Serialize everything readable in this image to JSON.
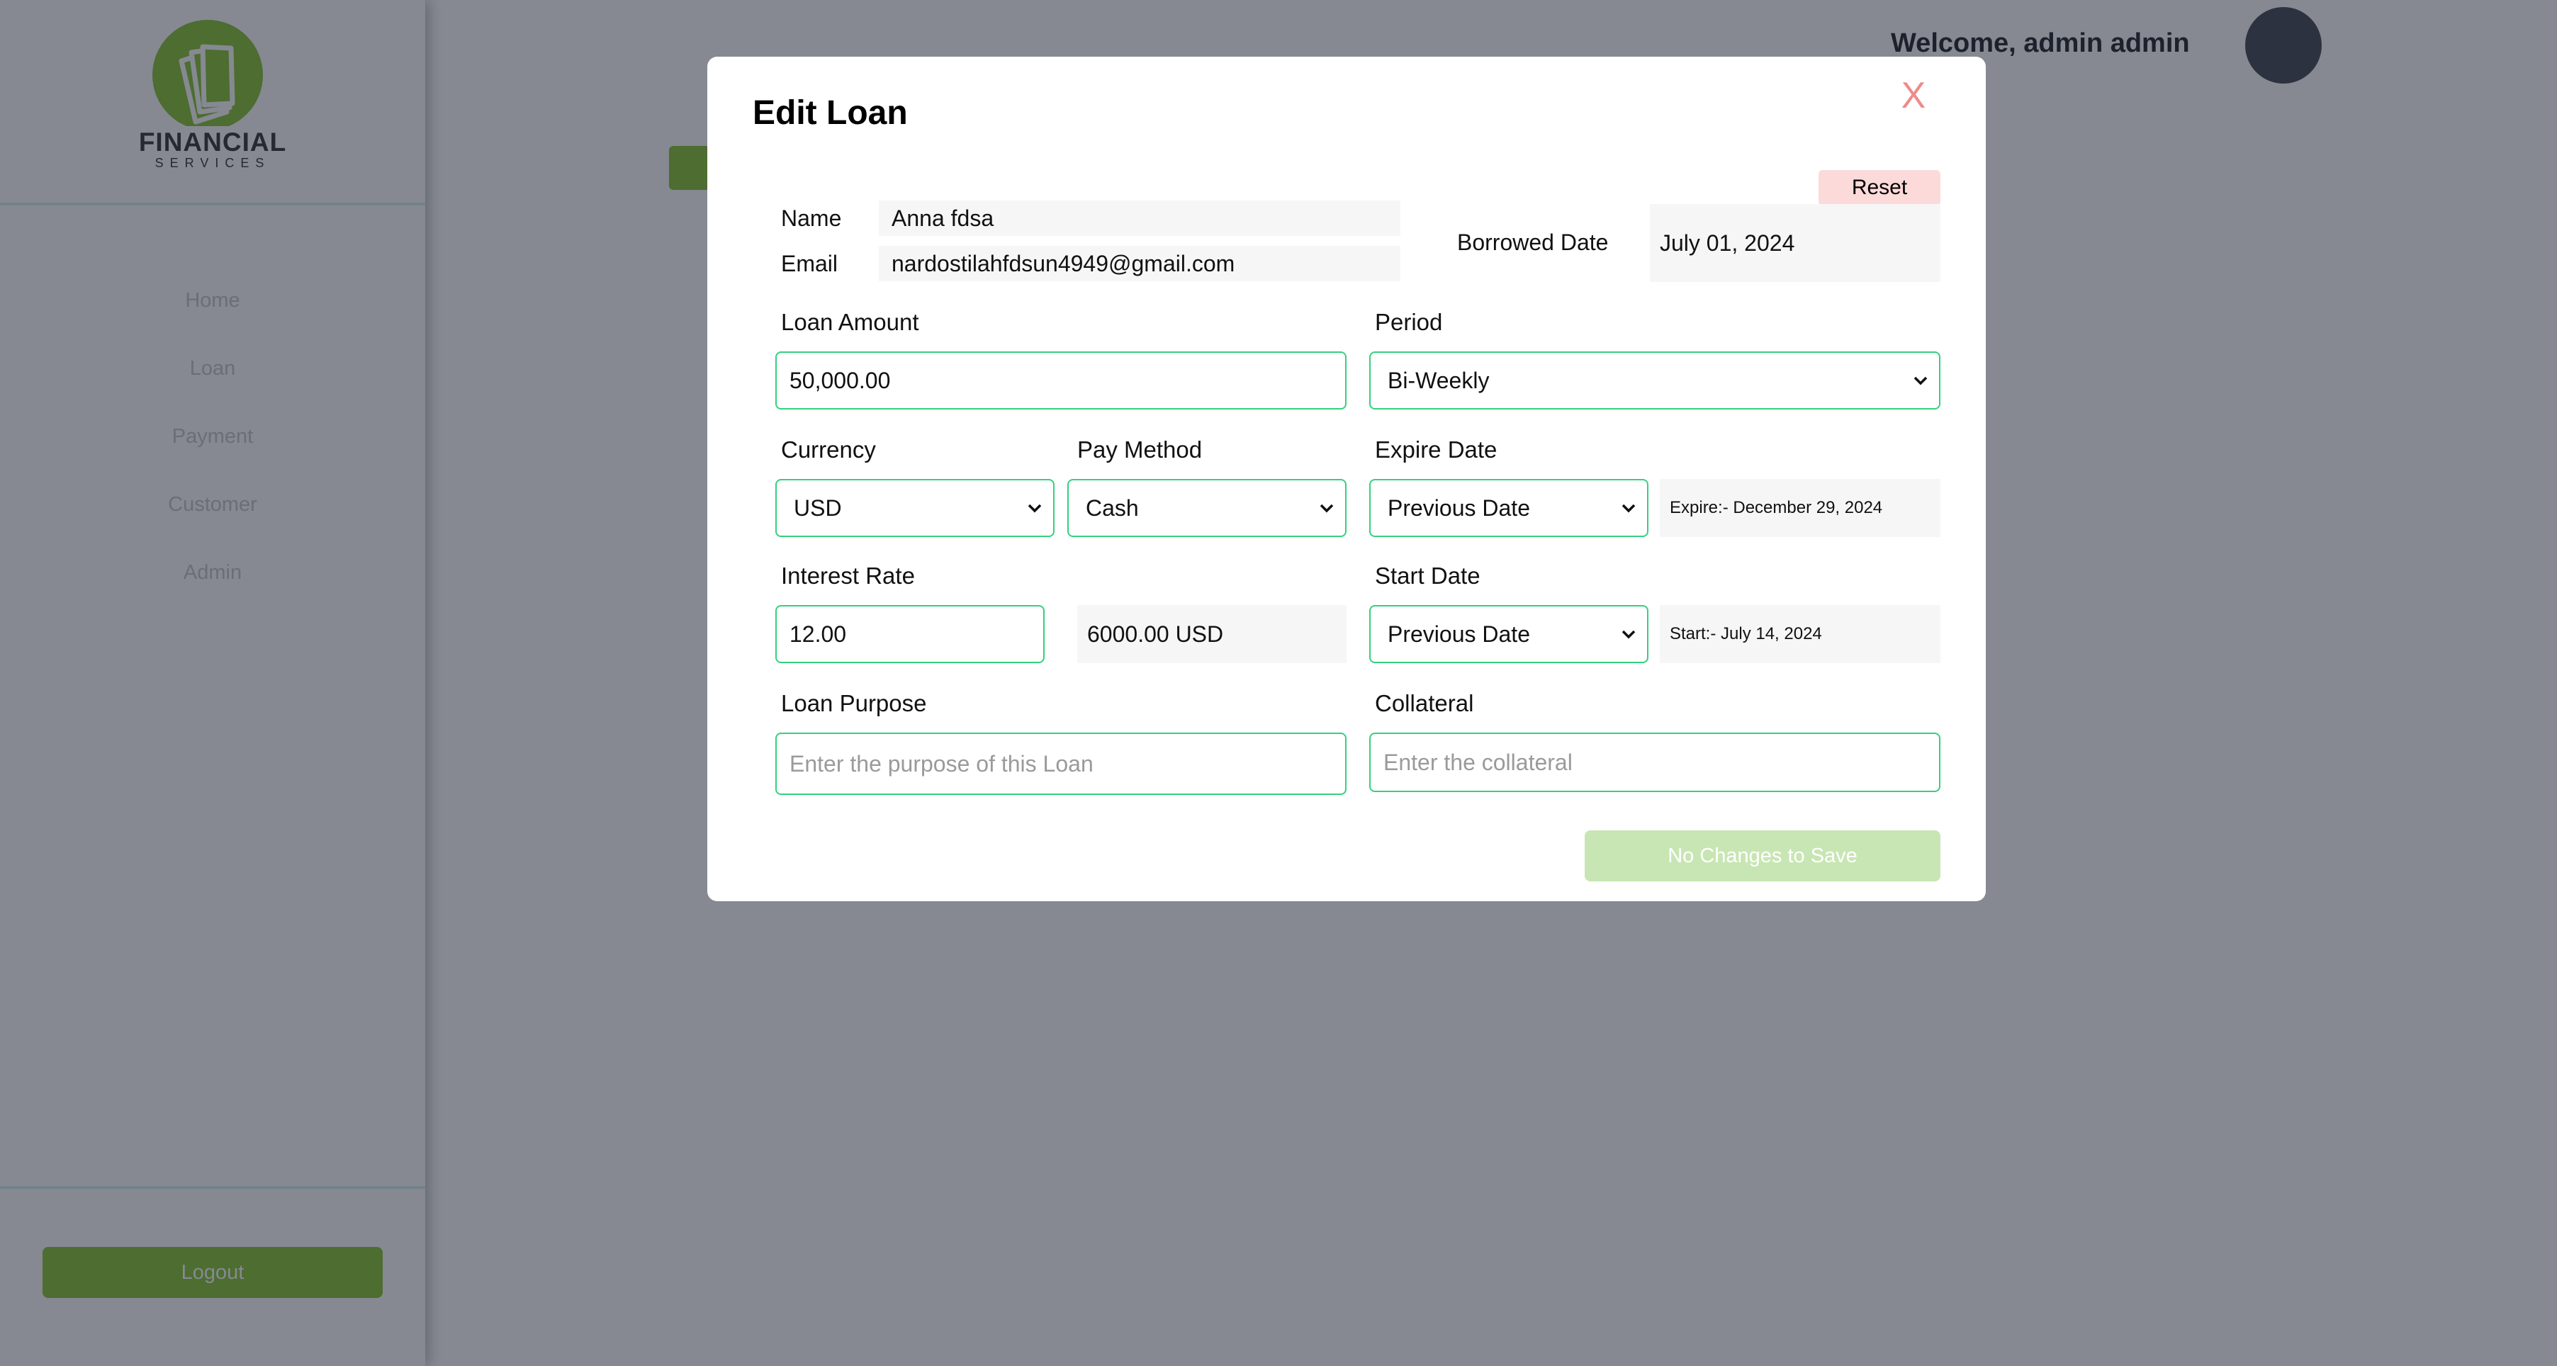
{
  "brand": {
    "title": "FINANCIAL",
    "subtitle": "SERVICES",
    "accent": "#8dc63f"
  },
  "sidebar": {
    "items": [
      {
        "label": "Home"
      },
      {
        "label": "Loan"
      },
      {
        "label": "Payment"
      },
      {
        "label": "Customer"
      },
      {
        "label": "Admin"
      }
    ],
    "logout_label": "Logout"
  },
  "header": {
    "welcome": "Welcome, admin admin"
  },
  "modal": {
    "title": "Edit Loan",
    "close_label": "X",
    "reset_label": "Reset",
    "name_label": "Name",
    "name_value": "Anna fdsa",
    "email_label": "Email",
    "email_value": "nardostilahfdsun4949@gmail.com",
    "borrowed_label": "Borrowed Date",
    "borrowed_value": "July 01, 2024",
    "loan_amount_label": "Loan Amount",
    "loan_amount_value": "50,000.00",
    "period_label": "Period",
    "period_value": "Bi-Weekly",
    "currency_label": "Currency",
    "currency_value": "USD",
    "pay_method_label": "Pay Method",
    "pay_method_value": "Cash",
    "expire_label": "Expire Date",
    "expire_select_value": "Previous Date",
    "expire_text": "Expire:- December 29, 2024",
    "interest_label": "Interest Rate",
    "interest_value": "12.00",
    "interest_amount": "6000.00 USD",
    "start_label": "Start Date",
    "start_select_value": "Previous Date",
    "start_text": "Start:- July 14, 2024",
    "purpose_label": "Loan Purpose",
    "purpose_placeholder": "Enter the purpose of this Loan",
    "collateral_label": "Collateral",
    "collateral_placeholder": "Enter the collateral",
    "save_label": "No Changes to Save"
  }
}
